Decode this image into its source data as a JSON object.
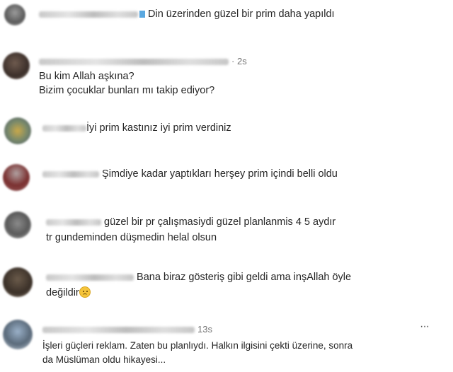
{
  "comments": [
    {
      "text": "Din üzerinden güzel bir prim daha yapıldı"
    },
    {
      "time": "· 2s",
      "line1": "Bu kim Allah aşkına?",
      "line2": "Bizim çocuklar bunları mı takip ediyor?"
    },
    {
      "text": "İyi prim kastınız iyi prim verdiniz"
    },
    {
      "text": "Şimdiye kadar yaptıkları herşey prim içindi belli oldu"
    },
    {
      "line1": "güzel bir pr çalışmasiydi güzel planlanmis 4 5 aydır",
      "line2": "tr gundeminden düşmedin helal olsun"
    },
    {
      "line1": "Bana biraz gösteriş gibi geldi ama inşAllah öyle",
      "line2": "değildir"
    },
    {
      "time": "13s",
      "more": "···",
      "line1": "İşleri güçleri reklam. Zaten bu planlıydı. Halkın ilgisini çekti üzerine, sonra",
      "line2": "da Müslüman oldu hikayesi..."
    }
  ],
  "icons": {
    "sad_emoji": "disappointed-face-emoji",
    "more": "more-options-icon"
  }
}
